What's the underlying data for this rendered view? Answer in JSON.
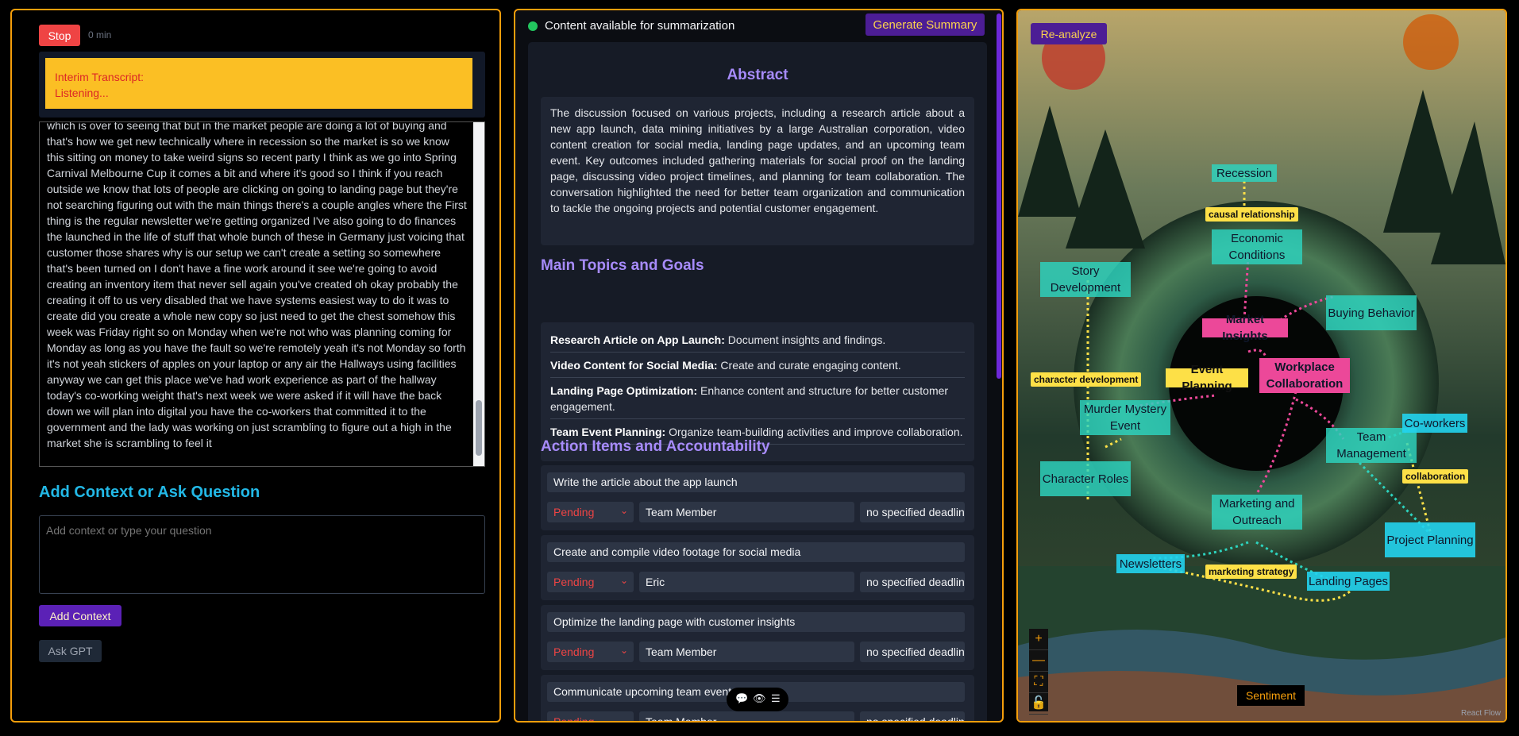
{
  "left": {
    "stop_label": "Stop",
    "timer": "0 min",
    "interim_title": "Interim Transcript:",
    "interim_status": "Listening...",
    "transcript": "which is over to seeing that but in the market people are doing a lot of buying and that's how we get new  technically where in recession  so the market is  so we know this sitting on money  to take weird signs so recent party I think as we go into Spring Carnival Melbourne Cup  it comes a bit  and where it's good  so I think  if you reach outside  we know that lots of people are clicking on going to landing page but they're not  searching figuring out with  the main things there's a couple angles where  the First  thing is the regular newsletter we're getting organized  I've also going to do finances the launched in  the life of stuff that whole bunch of these in Germany just  voicing that customer those shares why is our setup we can't create a setting so somewhere that's been turned on I don't have a fine work around it see we're going to avoid creating an inventory item that never sell again  you've created  oh okay  probably the creating it  off to us very disabled  that we have systems  easiest way to do it was to create did you create a whole new copy  so just need to get the chest somehow this week was  Friday right so on Monday when we're not who was planning coming for Monday  as long as you have the fault so we're remotely yeah  it's not Monday  so forth  it's not yeah  stickers of apples on your laptop  or any air the Hallways  using facilities  anyway we can get this place  we've had work experience  as part of the hallway  today's co-working weight that's next week we were asked if it will have  the back down  we will plan into  digital you have the co-workers  that committed it to the government  and the lady was working on just scrambling to figure out  a high in the market  she is scrambling to feel it",
    "context_title": "Add Context or Ask Question",
    "context_placeholder": "Add context or type your question",
    "add_context_label": "Add Context",
    "ask_gpt_label": "Ask GPT"
  },
  "middle": {
    "status": "Content available for summarization",
    "generate_label": "Generate Summary",
    "abstract_title": "Abstract",
    "abstract": "The discussion focused on various projects, including a research article about a new app launch, data mining initiatives by a large Australian corporation, video content creation for social media, landing page updates, and an upcoming team event. Key outcomes included gathering materials for social proof on the landing page, discussing video project timelines, and planning for team collaboration. The conversation highlighted the need for better team organization and communication to tackle the ongoing projects and potential customer engagement.",
    "topics_title": "Main Topics and Goals",
    "topics": [
      {
        "name": "Research Article on App Launch:",
        "desc": " Document insights and findings."
      },
      {
        "name": "Video Content for Social Media:",
        "desc": " Create and curate engaging content."
      },
      {
        "name": "Landing Page Optimization:",
        "desc": " Enhance content and structure for better customer engagement."
      },
      {
        "name": "Team Event Planning:",
        "desc": " Organize team-building activities and improve collaboration."
      }
    ],
    "actions_title": "Action Items and Accountability",
    "actions": [
      {
        "task": "Write the article about the app launch",
        "status": "Pending",
        "owner": "Team Member",
        "deadline": "no specified deadline"
      },
      {
        "task": "Create and compile video footage for social media",
        "status": "Pending",
        "owner": "Eric",
        "deadline": "no specified deadline"
      },
      {
        "task": "Optimize the landing page with customer insights",
        "status": "Pending",
        "owner": "Team Member",
        "deadline": "no specified deadline"
      },
      {
        "task": "Communicate upcoming team event details",
        "status": "Pending",
        "owner": "Team Member",
        "deadline": "no specified deadline"
      }
    ]
  },
  "right": {
    "reanalyze_label": "Re-analyze",
    "nodes": {
      "recession": "Recession",
      "economic": "Economic Conditions",
      "story": "Story Development",
      "market": "Market Insights",
      "buying": "Buying Behavior",
      "event": "Event Planning",
      "workplace": "Workplace Collaboration",
      "murder": "Murder Mystery Event",
      "team_mgmt": "Team Management",
      "coworkers": "Co-workers",
      "character": "Character Roles",
      "marketing": "Marketing and Outreach",
      "project": "Project Planning",
      "newsletters": "Newsletters",
      "landing": "Landing Pages"
    },
    "edge_labels": {
      "causal": "causal relationship",
      "character_dev": "character development",
      "collaboration": "collaboration",
      "marketing_strategy": "marketing strategy"
    },
    "sentiment_label": "Sentiment",
    "attribution": "React Flow",
    "controls": [
      "+",
      "—",
      "⛶",
      "🔓"
    ]
  }
}
